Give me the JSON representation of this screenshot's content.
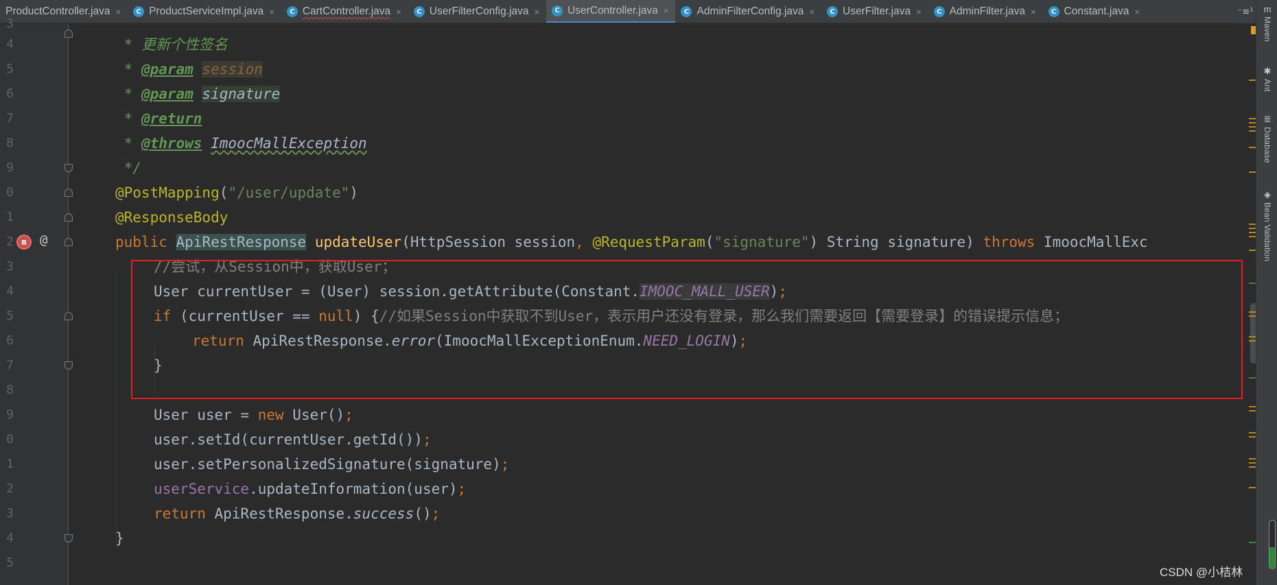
{
  "tabs": [
    {
      "label": "ProductController.java",
      "active": false,
      "error": false,
      "has_icon": false
    },
    {
      "label": "ProductServiceImpl.java",
      "active": false,
      "error": false,
      "has_icon": true
    },
    {
      "label": "CartController.java",
      "active": false,
      "error": true,
      "has_icon": true
    },
    {
      "label": "UserFilterConfig.java",
      "active": false,
      "error": false,
      "has_icon": true
    },
    {
      "label": "UserController.java",
      "active": true,
      "error": false,
      "has_icon": true
    },
    {
      "label": "AdminFilterConfig.java",
      "active": false,
      "error": false,
      "has_icon": true
    },
    {
      "label": "UserFilter.java",
      "active": false,
      "error": false,
      "has_icon": true
    },
    {
      "label": "AdminFilter.java",
      "active": false,
      "error": false,
      "has_icon": true
    },
    {
      "label": "Constant.java",
      "active": false,
      "error": false,
      "has_icon": true
    }
  ],
  "tab_close_glyph": "×",
  "tabs_overflow": "⁻≡¹",
  "right_tools": [
    {
      "icon": "m",
      "label": "Maven"
    },
    {
      "icon": "ant-icon",
      "label": "Ant"
    },
    {
      "icon": "database-icon",
      "label": "Database"
    },
    {
      "icon": "bean-icon",
      "label": "Bean Validation"
    }
  ],
  "line_numbers": [
    "3",
    "4",
    "5",
    "6",
    "7",
    "8",
    "9",
    "0",
    "1",
    "2",
    "3",
    "4",
    "5",
    "6",
    "7",
    "8",
    "9",
    "0",
    "1",
    "2",
    "3",
    "4",
    "5"
  ],
  "code": {
    "l4_a": " * ",
    "l4_doc": "更新个性签名",
    "l5_a": " * ",
    "l5_tag": "@param",
    "l5_sp": " ",
    "l5_par": "session",
    "l6_a": " * ",
    "l6_tag": "@param",
    "l6_sp": " ",
    "l6_par": "signature",
    "l7_a": " * ",
    "l7_tag": "@return",
    "l8_a": " * ",
    "l8_tag": "@throws",
    "l8_sp": " ",
    "l8_exc": "ImoocMallException",
    "l9": " */",
    "l10_ann": "@PostMapping",
    "l10_p1": "(",
    "l10_str": "\"/user/update\"",
    "l10_p2": ")",
    "l11_ann": "@ResponseBody",
    "l12_kw1": "public ",
    "l12_cls": "ApiRestResponse",
    "l12_sp": " ",
    "l12_fn": "updateUser",
    "l12_p1": "(HttpSession session",
    "l12_c1": ", ",
    "l12_ann": "@RequestParam",
    "l12_p2": "(",
    "l12_str": "\"signature\"",
    "l12_p3": ") String signature) ",
    "l12_kw2": "throws",
    "l12_p4": " ImoocMallExc",
    "l13_cmt": "//尝试，从Session中，获取User；",
    "l14_a": "User currentUser = (User) session.getAttribute(Constant.",
    "l14_const": "IMOOC_MALL_USER",
    "l14_b": ")",
    "l14_semi": ";",
    "l15_kw": "if",
    "l15_a": " (currentUser == ",
    "l15_null": "null",
    "l15_b": ") {",
    "l15_cmt": "//如果Session中获取不到User，表示用户还没有登录，那么我们需要返回【需要登录】的错误提示信息；",
    "l16_kw": "return",
    "l16_a": " ApiRestResponse.",
    "l16_fn": "error",
    "l16_b": "(ImoocMallExceptionEnum.",
    "l16_const": "NEED_LOGIN",
    "l16_c": ")",
    "l16_semi": ";",
    "l17": "}",
    "l19_a": "User user = ",
    "l19_kw": "new",
    "l19_b": " User()",
    "l19_semi": ";",
    "l20_a": "user.setId(currentUser.getId())",
    "l20_semi": ";",
    "l21_a": "user.setPersonalizedSignature(signature)",
    "l21_semi": ";",
    "l22_fld": "userService",
    "l22_a": ".updateInformation(user)",
    "l22_semi": ";",
    "l23_kw": "return",
    "l23_a": " ApiRestResponse.",
    "l23_fn": "success",
    "l23_b": "()",
    "l23_semi": ";",
    "l24": "}"
  },
  "gutter_icons": {
    "implements": "m",
    "annotation": "@"
  },
  "watermark": "CSDN @小桔林",
  "memory_fill_fraction": 0.45,
  "colors": {
    "keyword": "#cc7832",
    "annotation": "#bbb529",
    "string": "#6a8759",
    "method": "#ffc66d",
    "field": "#9876aa",
    "comment": "#808080",
    "doc": "#629755",
    "text": "#a9b7c6",
    "highlight_box": "#e02020"
  }
}
